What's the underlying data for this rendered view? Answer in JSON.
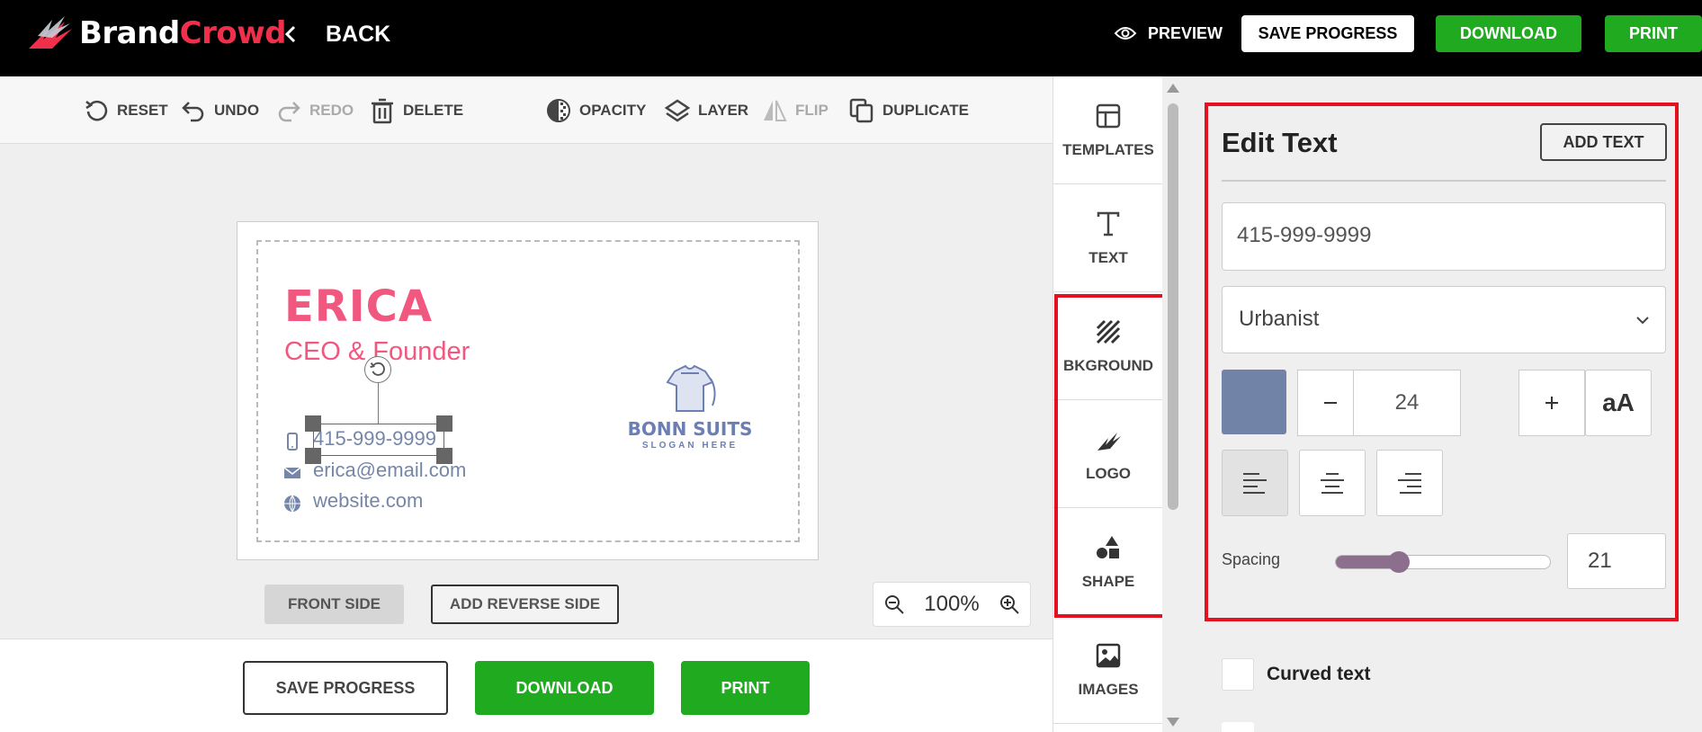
{
  "header": {
    "logo_brand": "Brand",
    "logo_crowd": "Crowd",
    "back_label": "BACK",
    "preview_label": "PREVIEW",
    "save_label": "SAVE PROGRESS",
    "download_label": "DOWNLOAD",
    "print_label": "PRINT"
  },
  "toolbar": {
    "reset": "RESET",
    "undo": "UNDO",
    "redo": "REDO",
    "delete": "DELETE",
    "opacity": "OPACITY",
    "layer": "LAYER",
    "flip": "FLIP",
    "duplicate": "DUPLICATE"
  },
  "card": {
    "name": "ERICA",
    "role": "CEO & Founder",
    "phone": "415-999-9999",
    "email": "erica@email.com",
    "website": "website.com",
    "brand_name": "BONN SUITS",
    "brand_slogan": "SLOGAN HERE"
  },
  "canvas": {
    "front_side": "FRONT SIDE",
    "reverse_side": "ADD REVERSE SIDE",
    "zoom": "100%"
  },
  "bottom": {
    "save_label": "SAVE PROGRESS",
    "download_label": "DOWNLOAD",
    "print_label": "PRINT"
  },
  "sidenav": {
    "items": [
      {
        "label": "TEMPLATES",
        "icon": "templates-icon"
      },
      {
        "label": "TEXT",
        "icon": "text-icon"
      },
      {
        "label": "BKGROUND",
        "icon": "background-icon"
      },
      {
        "label": "LOGO",
        "icon": "logo-icon"
      },
      {
        "label": "SHAPE",
        "icon": "shape-icon"
      },
      {
        "label": "IMAGES",
        "icon": "images-icon"
      }
    ]
  },
  "panel": {
    "title": "Edit Text",
    "add_text": "ADD TEXT",
    "text_value": "415-999-9999",
    "font": "Urbanist",
    "font_size": "24",
    "case_label": "aA",
    "spacing_label": "Spacing",
    "spacing_value": "21",
    "spacing_fraction": 0.25,
    "curved_label": "Curved text",
    "color": "#7183a6"
  },
  "colors": {
    "accent_green": "#1faa1f",
    "highlight_red": "#e4121e",
    "name_pink": "#f0587f",
    "slider": "#8c6f8c"
  }
}
